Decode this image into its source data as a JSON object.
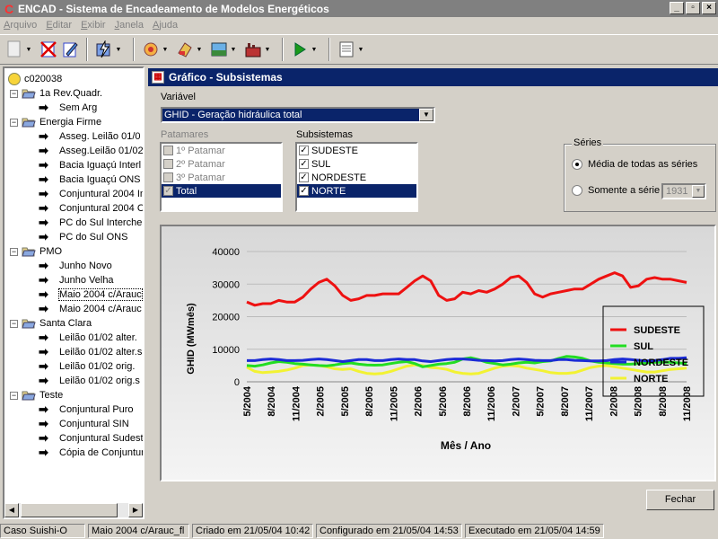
{
  "app": {
    "title": "ENCAD - Sistema de Encadeamento de Modelos Energéticos",
    "window_buttons": [
      "_",
      "▫",
      "×"
    ]
  },
  "menu": [
    "Arquivo",
    "Editar",
    "Exibir",
    "Janela",
    "Ajuda"
  ],
  "tree": {
    "root": "c020038",
    "groups": [
      {
        "label": "1a Rev.Quadr.",
        "items": [
          "Sem Arg"
        ]
      },
      {
        "label": "Energia Firme",
        "items": [
          "Asseg. Leilão 01/0",
          "Asseg.Leilão 01/02",
          "Bacia Iguaçú Interl",
          "Bacia Iguaçú ONS",
          "Conjuntural 2004 In",
          "Conjuntural 2004 C",
          "PC do Sul Intercheb",
          "PC do Sul ONS"
        ]
      },
      {
        "label": "PMO",
        "items": [
          "Junho Novo",
          "Junho Velha",
          "Maio 2004 c/Arauc",
          "Maio 2004 c/Arauc"
        ]
      },
      {
        "label": "Santa Clara",
        "items": [
          "Leilão 01/02 alter.",
          "Leilão 01/02 alter.s",
          "Leilão 01/02 orig.",
          "Leilão 01/02 orig.s"
        ]
      },
      {
        "label": "Teste",
        "items": [
          "Conjuntural Puro",
          "Conjuntural SIN",
          "Conjuntural Sudest",
          "Cópia de Conjuntur"
        ]
      }
    ]
  },
  "child": {
    "title": "Gráfico - Subsistemas",
    "variavel_label": "Variável",
    "variavel_value": "GHID - Geração hidráulica total",
    "patamares_label": "Patamares",
    "patamares": [
      "1º Patamar",
      "2º Patamar",
      "3º Patamar",
      "Total"
    ],
    "subsistemas_label": "Subsistemas",
    "subsistemas": [
      "SUDESTE",
      "SUL",
      "NORDESTE",
      "NORTE"
    ],
    "series_label": "Séries",
    "radio_media": "Média de todas as séries",
    "radio_serie": "Somente a série",
    "serie_value": "1931",
    "close_button": "Fechar"
  },
  "chart_data": {
    "type": "line",
    "xlabel": "Mês / Ano",
    "ylabel": "GHID (MWmês)",
    "ylim": [
      0,
      40000
    ],
    "yticks": [
      "0",
      "10000",
      "20000",
      "30000",
      "40000"
    ],
    "xticks": [
      "5/2004",
      "8/2004",
      "11/2004",
      "2/2005",
      "5/2005",
      "8/2005",
      "11/2005",
      "2/2006",
      "5/2006",
      "8/2006",
      "11/2006",
      "2/2007",
      "5/2007",
      "8/2007",
      "11/2007",
      "2/2008",
      "5/2008",
      "8/2008",
      "11/2008"
    ],
    "legend_position": "right",
    "series": [
      {
        "name": "SUDESTE",
        "color": "#ee1111",
        "values": [
          24500,
          23500,
          24000,
          24000,
          25000,
          24500,
          24500,
          26000,
          28500,
          30500,
          31500,
          29500,
          26500,
          25000,
          25500,
          26500,
          26500,
          27000,
          27000,
          27000,
          29000,
          31000,
          32500,
          31000,
          26500,
          25000,
          25500,
          27500,
          27000,
          28000,
          27500,
          28500,
          30000,
          32000,
          32500,
          30500,
          27000,
          26000,
          27000,
          27500,
          28000,
          28500,
          28500,
          30000,
          31500,
          32500,
          33500,
          32500,
          29000,
          29500,
          31500,
          32000,
          31500,
          31500,
          31000,
          30500
        ]
      },
      {
        "name": "SUL",
        "color": "#22dd22",
        "values": [
          5000,
          4800,
          5200,
          5800,
          6200,
          6000,
          5600,
          5400,
          5200,
          5000,
          4900,
          5200,
          5600,
          5800,
          5400,
          5200,
          5100,
          5200,
          5600,
          6000,
          6200,
          5600,
          4600,
          5000,
          5400,
          5600,
          6000,
          7000,
          7400,
          6800,
          6000,
          5600,
          5200,
          5400,
          5800,
          6000,
          5800,
          6200,
          6400,
          7200,
          7800,
          7600,
          7200,
          6400,
          6000,
          5800,
          5600,
          5400,
          5400,
          5600,
          5800,
          6000,
          6000,
          6000,
          5800,
          5600
        ]
      },
      {
        "name": "NORDESTE",
        "color": "#1b2bd6",
        "values": [
          6500,
          6500,
          6800,
          7000,
          6800,
          6500,
          6500,
          6600,
          6800,
          7000,
          6800,
          6500,
          6200,
          6500,
          6800,
          6800,
          6500,
          6500,
          6800,
          7000,
          6800,
          6800,
          6400,
          6200,
          6500,
          6800,
          7000,
          7000,
          6800,
          6600,
          6500,
          6400,
          6500,
          6800,
          7000,
          6800,
          6600,
          6500,
          6500,
          6800,
          6800,
          6600,
          6500,
          6400,
          6400,
          6500,
          6800,
          7000,
          6800,
          6600,
          6400,
          6500,
          6800,
          7200,
          7200,
          7400
        ]
      },
      {
        "name": "NORTE",
        "color": "#f2f232",
        "values": [
          4500,
          3200,
          2800,
          3000,
          3200,
          3600,
          4200,
          5000,
          5200,
          5000,
          4600,
          4000,
          3800,
          4000,
          3200,
          2600,
          2400,
          2600,
          3200,
          4000,
          4800,
          5200,
          5000,
          4400,
          4200,
          3800,
          3000,
          2600,
          2400,
          2600,
          3400,
          4200,
          4800,
          5000,
          4800,
          4200,
          3800,
          3400,
          2800,
          2600,
          2600,
          2800,
          3600,
          4400,
          4800,
          5000,
          4600,
          4200,
          3800,
          3400,
          3000,
          3000,
          3400,
          3800,
          4000,
          4200
        ]
      }
    ]
  },
  "status": [
    "Caso Suishi-O",
    "Maio 2004 c/Arauc_fl",
    "Criado em 21/05/04 10:42",
    "Configurado em 21/05/04 14:53",
    "Executado em 21/05/04 14:59"
  ]
}
